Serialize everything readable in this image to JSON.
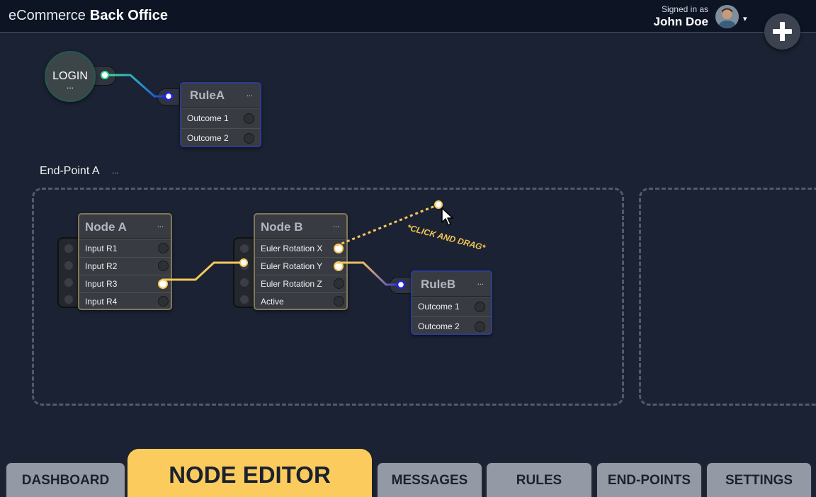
{
  "header": {
    "brand_light": "eCommerce",
    "brand_bold": "Back Office",
    "signed_in_label": "Signed in as",
    "user_name": "John Doe",
    "dropdown_glyph": "▾",
    "add_icon": "plus-icon"
  },
  "canvas": {
    "login_node": {
      "label": "LOGIN",
      "more": "..."
    },
    "rule_a": {
      "title": "RuleA",
      "more": "...",
      "outcomes": [
        "Outcome 1",
        "Outcome 2"
      ]
    },
    "endpoint": {
      "label": "End-Point A",
      "more": "..."
    },
    "node_a": {
      "title": "Node A",
      "more": "...",
      "inputs": [
        "Input R1",
        "Input R2",
        "Input R3",
        "Input R4"
      ]
    },
    "node_b": {
      "title": "Node B",
      "more": "...",
      "outputs": [
        "Euler Rotation X",
        "Euler Rotation Y",
        "Euler Rotation Z",
        "Active"
      ]
    },
    "rule_b": {
      "title": "RuleB",
      "more": "...",
      "outcomes": [
        "Outcome 1",
        "Outcome 2"
      ]
    },
    "hint": "*CLICK AND DRAG*"
  },
  "colors": {
    "background": "#1b2233",
    "header": "#0d1424",
    "accent_yellow": "#fbcb5d",
    "wire_green": "#3ddc97",
    "wire_blue": "#1d23e0",
    "tab_inactive": "#949aa5"
  },
  "tabs": [
    {
      "label": "DASHBOARD",
      "active": false
    },
    {
      "label": "NODE EDITOR",
      "active": true
    },
    {
      "label": "MESSAGES",
      "active": false
    },
    {
      "label": "RULES",
      "active": false
    },
    {
      "label": "END-POINTS",
      "active": false
    },
    {
      "label": "SETTINGS",
      "active": false
    }
  ]
}
